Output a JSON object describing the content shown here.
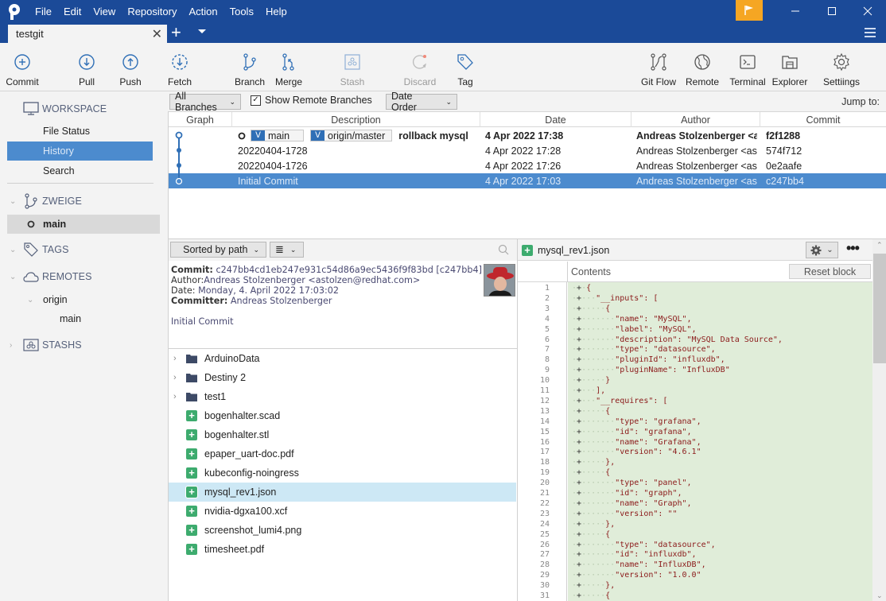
{
  "menu": [
    "File",
    "Edit",
    "View",
    "Repository",
    "Action",
    "Tools",
    "Help"
  ],
  "tab": {
    "title": "testgit"
  },
  "toolbar": {
    "left": [
      {
        "label": "Commit",
        "icon": "commit-icon"
      },
      {
        "label": "Pull",
        "icon": "pull-icon"
      },
      {
        "label": "Push",
        "icon": "push-icon"
      },
      {
        "label": "Fetch",
        "icon": "fetch-icon"
      },
      {
        "label": "Branch",
        "icon": "branch-icon"
      },
      {
        "label": "Merge",
        "icon": "merge-icon"
      },
      {
        "label": "Stash",
        "icon": "stash-icon",
        "disabled": true
      },
      {
        "label": "Discard",
        "icon": "discard-icon",
        "disabled": true
      },
      {
        "label": "Tag",
        "icon": "tag-icon"
      }
    ],
    "right": [
      {
        "label": "Git Flow",
        "icon": "git-flow-icon"
      },
      {
        "label": "Remote",
        "icon": "globe-icon"
      },
      {
        "label": "Terminal",
        "icon": "terminal-icon"
      },
      {
        "label": "Explorer",
        "icon": "folder-icon"
      },
      {
        "label": "Settiings",
        "icon": "gear-icon"
      }
    ]
  },
  "sidebar": {
    "workspace": {
      "title": "WORKSPACE",
      "items": [
        "File Status",
        "History",
        "Search"
      ],
      "active": "History"
    },
    "branches": {
      "title": "ZWEIGE",
      "items": [
        "main"
      ]
    },
    "tags": {
      "title": "TAGS"
    },
    "remotes": {
      "title": "REMOTES",
      "origin": "origin",
      "origin_branches": [
        "main"
      ]
    },
    "stashes": {
      "title": "STASHS"
    }
  },
  "filterbar": {
    "branches": "All Branches",
    "show_remote": "Show Remote Branches",
    "show_remote_checked": true,
    "order": "Date Order",
    "jump_to": "Jump to:"
  },
  "history": {
    "columns": [
      "Graph",
      "Description",
      "Date",
      "Author",
      "Commit"
    ],
    "rows": [
      {
        "refs": [
          "main",
          "origin/master"
        ],
        "description": "rollback mysql",
        "date": "4 Apr 2022 17:38",
        "author": "Andreas Stolzenberger <as",
        "commit": "f2f1288",
        "bold": true
      },
      {
        "refs": [],
        "description": "20220404-1728",
        "date": "4 Apr 2022 17:28",
        "author": "Andreas Stolzenberger <asto",
        "commit": "574f712"
      },
      {
        "refs": [],
        "description": "20220404-1726",
        "date": "4 Apr 2022 17:26",
        "author": "Andreas Stolzenberger <asto",
        "commit": "0e2aafe"
      },
      {
        "refs": [],
        "description": "Initial  Commit",
        "date": "4 Apr 2022 17:03",
        "author": "Andreas Stolzenberger <asto",
        "commit": "c247bb4",
        "selected": true
      }
    ]
  },
  "details": {
    "sort": "Sorted by path",
    "commit_label": "Commit:",
    "commit_value": "c247bb4cd1eb247e931c54d86a9ec5436f9f83bd [c247bb4]",
    "author_label": "Author:",
    "author_value": "Andreas Stolzenberger <astolzen@redhat.com>",
    "date_label": "Date:",
    "date_value": "Monday, 4. April 2022 17:03:02",
    "committer_label": "Committer:",
    "committer_value": "Andreas Stolzenberger",
    "message": "Initial Commit"
  },
  "files": [
    {
      "name": "ArduinoData",
      "type": "folder"
    },
    {
      "name": "Destiny 2",
      "type": "folder"
    },
    {
      "name": "test1",
      "type": "folder"
    },
    {
      "name": "bogenhalter.scad",
      "type": "added"
    },
    {
      "name": "bogenhalter.stl",
      "type": "added"
    },
    {
      "name": "epaper_uart-doc.pdf",
      "type": "added"
    },
    {
      "name": "kubeconfig-noingress",
      "type": "added"
    },
    {
      "name": "mysql_rev1.json",
      "type": "added",
      "selected": true
    },
    {
      "name": "nvidia-dgxa100.xcf",
      "type": "added"
    },
    {
      "name": "screenshot_lumi4.png",
      "type": "added"
    },
    {
      "name": "timesheet.pdf",
      "type": "added"
    }
  ],
  "diff": {
    "filename": "mysql_rev1.json",
    "contents_label": "Contents",
    "reset_label": "Reset block",
    "lines": [
      "{",
      "  \"__inputs\": [",
      "    {",
      "      \"name\": \"MySQL\",",
      "      \"label\": \"MySQL\",",
      "      \"description\": \"MySQL Data Source\",",
      "      \"type\": \"datasource\",",
      "      \"pluginId\": \"influxdb\",",
      "      \"pluginName\": \"InfluxDB\"",
      "    }",
      "  ],",
      "  \"__requires\": [",
      "    {",
      "      \"type\": \"grafana\",",
      "      \"id\": \"grafana\",",
      "      \"name\": \"Grafana\",",
      "      \"version\": \"4.6.1\"",
      "    },",
      "    {",
      "      \"type\": \"panel\",",
      "      \"id\": \"graph\",",
      "      \"name\": \"Graph\",",
      "      \"version\": \"\"",
      "    },",
      "    {",
      "      \"type\": \"datasource\",",
      "      \"id\": \"influxdb\",",
      "      \"name\": \"InfluxDB\",",
      "      \"version\": \"1.0.0\"",
      "    },",
      "    {"
    ]
  }
}
